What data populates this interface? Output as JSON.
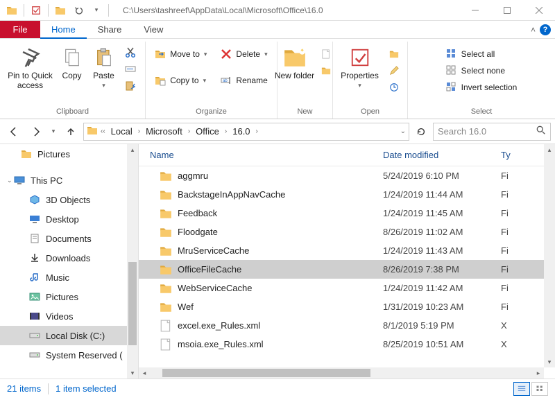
{
  "titlebar": {
    "path": "C:\\Users\\tashreef\\AppData\\Local\\Microsoft\\Office\\16.0"
  },
  "tabs": {
    "file": "File",
    "home": "Home",
    "share": "Share",
    "view": "View"
  },
  "ribbon": {
    "clipboard": {
      "pin": "Pin to Quick access",
      "copy": "Copy",
      "paste": "Paste",
      "label": "Clipboard"
    },
    "organize": {
      "move": "Move to",
      "copy": "Copy to",
      "delete": "Delete",
      "rename": "Rename",
      "label": "Organize"
    },
    "new": {
      "newfolder": "New folder",
      "label": "New"
    },
    "open": {
      "properties": "Properties",
      "label": "Open"
    },
    "select": {
      "all": "Select all",
      "none": "Select none",
      "invert": "Invert selection",
      "label": "Select"
    }
  },
  "breadcrumb": {
    "items": [
      "Local",
      "Microsoft",
      "Office",
      "16.0"
    ]
  },
  "search": {
    "placeholder": "Search 16.0"
  },
  "nav": {
    "pictures": "Pictures",
    "thispc": "This PC",
    "items": [
      "3D Objects",
      "Desktop",
      "Documents",
      "Downloads",
      "Music",
      "Pictures",
      "Videos",
      "Local Disk (C:)",
      "System Reserved ("
    ]
  },
  "columns": {
    "name": "Name",
    "date": "Date modified",
    "type": "Ty"
  },
  "files": [
    {
      "name": "aggmru",
      "date": "5/24/2019 6:10 PM",
      "type": "Fi",
      "kind": "folder"
    },
    {
      "name": "BackstageInAppNavCache",
      "date": "1/24/2019 11:44 AM",
      "type": "Fi",
      "kind": "folder"
    },
    {
      "name": "Feedback",
      "date": "1/24/2019 11:45 AM",
      "type": "Fi",
      "kind": "folder"
    },
    {
      "name": "Floodgate",
      "date": "8/26/2019 11:02 AM",
      "type": "Fi",
      "kind": "folder"
    },
    {
      "name": "MruServiceCache",
      "date": "1/24/2019 11:43 AM",
      "type": "Fi",
      "kind": "folder"
    },
    {
      "name": "OfficeFileCache",
      "date": "8/26/2019 7:38 PM",
      "type": "Fi",
      "kind": "folder",
      "selected": true
    },
    {
      "name": "WebServiceCache",
      "date": "1/24/2019 11:42 AM",
      "type": "Fi",
      "kind": "folder"
    },
    {
      "name": "Wef",
      "date": "1/31/2019 10:23 AM",
      "type": "Fi",
      "kind": "folder"
    },
    {
      "name": "excel.exe_Rules.xml",
      "date": "8/1/2019 5:19 PM",
      "type": "X",
      "kind": "file"
    },
    {
      "name": "msoia.exe_Rules.xml",
      "date": "8/25/2019 10:51 AM",
      "type": "X",
      "kind": "file"
    }
  ],
  "status": {
    "count": "21 items",
    "selected": "1 item selected"
  }
}
